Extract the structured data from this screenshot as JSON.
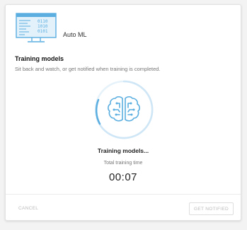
{
  "header": {
    "title": "Auto ML",
    "icon": "automl-monitor-icon"
  },
  "section": {
    "title": "Training models",
    "subtitle": "Sit back and watch, or get notified when training is completed."
  },
  "status": {
    "title": "Training models...",
    "label": "Total training time",
    "timer": "00:07",
    "spinner_icon": "brain-circuit-icon"
  },
  "footer": {
    "cancel_label": "CANCEL",
    "notify_label": "GET NOTIFIED"
  },
  "colors": {
    "accent": "#5aaee0",
    "accent_light": "#cfe6f6"
  }
}
